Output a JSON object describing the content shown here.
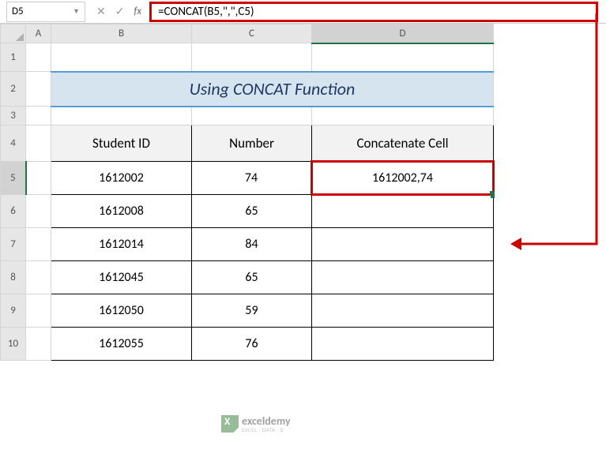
{
  "name_box": "D5",
  "formula": "=CONCAT(B5,\",\",C5)",
  "column_headers": [
    "A",
    "B",
    "C",
    "D"
  ],
  "row_headers": [
    "1",
    "2",
    "3",
    "4",
    "5",
    "6",
    "7",
    "8",
    "9",
    "10"
  ],
  "title": "Using CONCAT Function",
  "headers": {
    "b": "Student ID",
    "c": "Number",
    "d": "Concatenate Cell"
  },
  "active_cell": "D5",
  "fx_label": "fx",
  "chart_data": {
    "type": "table",
    "columns": [
      "Student ID",
      "Number",
      "Concatenate Cell"
    ],
    "rows": [
      {
        "id": "1612002",
        "num": "74",
        "concat": "1612002,74"
      },
      {
        "id": "1612008",
        "num": "65",
        "concat": ""
      },
      {
        "id": "1612014",
        "num": "84",
        "concat": ""
      },
      {
        "id": "1612045",
        "num": "65",
        "concat": ""
      },
      {
        "id": "1612050",
        "num": "59",
        "concat": ""
      },
      {
        "id": "1612055",
        "num": "76",
        "concat": ""
      }
    ]
  },
  "watermark": {
    "brand": "exceldemy",
    "tagline": "EXCEL · DATA · B"
  }
}
